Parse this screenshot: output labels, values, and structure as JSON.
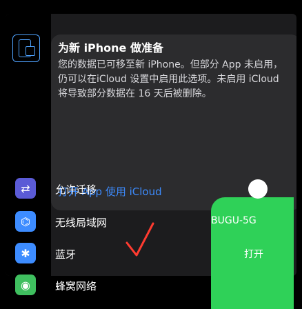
{
  "header": {
    "title": "为新 iPhone 做准备",
    "description": "您的数据已可移至新 iPhone。但部分 App 未启用，仍可以在iCloud 设置中启用此选项。未启用 iCloud 将导致部分数据在 16 天后被删除。",
    "link": "打开 App 使用 iCloud"
  },
  "rows": [
    {
      "label": "允许迁移",
      "value": "",
      "icon_color": "#5b5bd6"
    },
    {
      "label": "无线局域网",
      "value": "BUGU-5G",
      "icon_color": "#3d8cff"
    },
    {
      "label": "蓝牙",
      "value": "打开",
      "icon_color": "#3d8cff"
    },
    {
      "label": "蜂窝网络",
      "value": "",
      "icon_color": "#3fbf5f"
    }
  ],
  "colors": {
    "accent": "#3d8cff",
    "green": "#2fd158"
  },
  "icons": [
    "iphone-transfer-icon",
    "transfer-icon",
    "wifi-icon",
    "bluetooth-icon",
    "cellular-icon",
    "checkmark-icon"
  ]
}
